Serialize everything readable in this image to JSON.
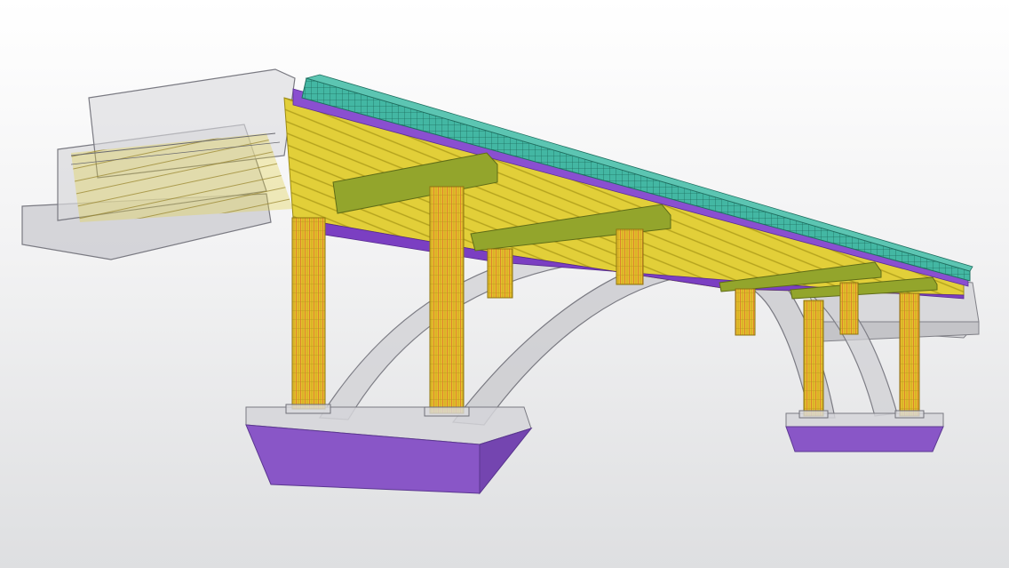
{
  "scene": {
    "subject": "bridge-3d-model",
    "view": "perspective",
    "colors": {
      "background_top": "#ffffff",
      "background_bottom": "#dedfe1",
      "concrete_fill": "#c9c9cc",
      "concrete_stroke": "#7d7d82",
      "column_fill": "#e8c230",
      "column_stroke": "#a88a12",
      "beam_fill": "#8fa32a",
      "girder_fill": "#e3d23a",
      "deck_top": "#3fb3a0",
      "deck_mesh": "#1d6f60",
      "purple": "#8a55c8",
      "rebar_red": "#d6402a",
      "rebar_blue": "#3a7bd5"
    }
  }
}
